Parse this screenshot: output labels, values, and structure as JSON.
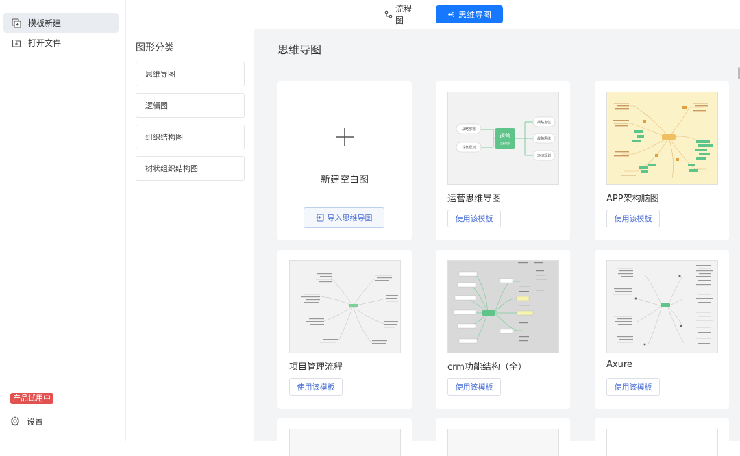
{
  "sidebar": {
    "items": [
      {
        "label": "模板新建",
        "icon": "template-new-icon",
        "active": true
      },
      {
        "label": "打开文件",
        "icon": "open-file-icon",
        "active": false
      }
    ],
    "trial_badge": "产品试用中",
    "settings_label": "设置"
  },
  "topbar": {
    "tabs": [
      {
        "label": "流程图",
        "icon": "flowchart-icon",
        "active": false
      },
      {
        "label": "思维导图",
        "icon": "mindmap-icon",
        "active": true
      }
    ]
  },
  "categories": {
    "title": "图形分类",
    "items": [
      "思维导图",
      "逻辑图",
      "组织结构图",
      "树状组织结构图"
    ]
  },
  "main": {
    "title": "思维导图",
    "new_blank": {
      "label": "新建空白图",
      "import_label": "导入思维导图"
    },
    "use_label": "使用该模板",
    "templates": [
      {
        "title": "运营思维导图",
        "thumb": "green-center"
      },
      {
        "title": "APP架构脑图",
        "thumb": "yellow-map"
      },
      {
        "title": "项目管理流程",
        "thumb": "light-tree"
      },
      {
        "title": "crm功能结构（全）",
        "thumb": "gray-map"
      },
      {
        "title": "Axure",
        "thumb": "light-tree-2"
      }
    ],
    "ops_thumb_text": {
      "center": "运营",
      "center_sub": "运营助手",
      "left": [
        "战略部署",
        "业务规划"
      ],
      "right": [
        "战略定位",
        "战略思维",
        "SKU规划"
      ]
    }
  },
  "colors": {
    "accent": "#1677ff",
    "badge": "#e0514f",
    "link": "#4b6fd7",
    "main_bg": "#f3f4f6",
    "mind_green": "#5fc48a"
  }
}
